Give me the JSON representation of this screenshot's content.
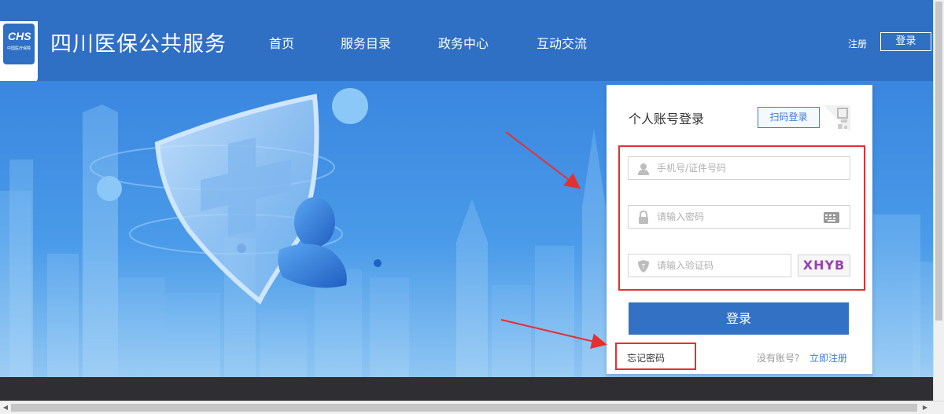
{
  "header": {
    "logo_text": "CHS",
    "logo_sub": "中国医疗保障",
    "title": "四川医保公共服务",
    "nav": [
      "首页",
      "服务目录",
      "政务中心",
      "互动交流"
    ],
    "register": "注册",
    "login": "登录"
  },
  "login_card": {
    "title": "个人账号登录",
    "qr_tab": "扫码登录",
    "username_placeholder": "手机号/证件号码",
    "password_placeholder": "请输入密码",
    "captcha_placeholder": "请输入验证码",
    "captcha_text": "XHYB",
    "submit": "登录",
    "forgot": "忘记密码",
    "no_account": "没有账号?",
    "register_link": "立即注册"
  },
  "colors": {
    "brand": "#2f6fc4",
    "button": "#3371c4",
    "annotation": "#e53030"
  }
}
